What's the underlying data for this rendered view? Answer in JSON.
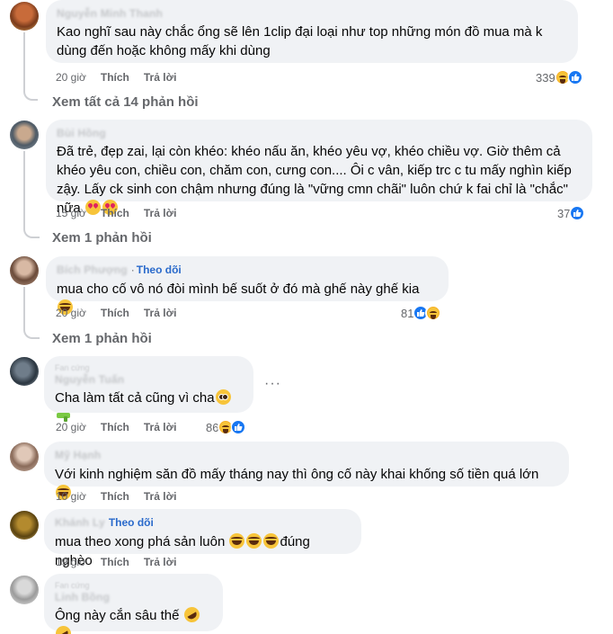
{
  "comments": [
    {
      "author": "Nguyễn Minh Thanh",
      "text": "Kao nghĩ sau này chắc ổng sẽ lên 1clip đại loại như top những món đồ mua mà k dùng đến hoặc không mấy khi dùng",
      "time": "20 giờ",
      "like_label": "Thích",
      "reply_label": "Trả lời",
      "reaction_count": "339",
      "reactions": [
        "haha",
        "like"
      ],
      "replies_label": "Xem tất cả 14 phản hồi"
    },
    {
      "author": "Bùi Hồng",
      "text": "Đã trẻ, đẹp zai, lại còn khéo: khéo nấu ăn, khéo yêu vợ, khéo chiều vợ. Giờ thêm cả khéo yêu con, chiều con, chăm con, cưng con.... Ôi c vân, kiếp trc c tu mấy nghìn kiếp zậy. Lấy ck sinh con chậm nhưng đúng là \"vững cmn chãi\" luôn chứ k fai chỉ là \"chắc\" nữa",
      "time": "15 giờ",
      "like_label": "Thích",
      "reply_label": "Trả lời",
      "reaction_count": "37",
      "reactions": [
        "like"
      ],
      "replies_label": "Xem 1 phản hồi"
    },
    {
      "author": "Bích Phượng",
      "follow_label": "Theo dõi",
      "text": "mua cho cố vô nó đòi mình bế suốt ở đó mà ghế này ghế kia",
      "time": "20 giờ",
      "like_label": "Thích",
      "reply_label": "Trả lời",
      "reaction_count": "81",
      "reactions": [
        "like",
        "haha"
      ],
      "replies_label": "Xem 1 phản hồi"
    },
    {
      "badge": "Fan cứng",
      "author": "Nguyễn Tuấn",
      "text": "Cha làm tất cả cũng vì cha",
      "time": "20 giờ",
      "like_label": "Thích",
      "reply_label": "Trả lời",
      "reaction_count": "86",
      "reactions": [
        "haha",
        "like"
      ],
      "more_label": "···"
    },
    {
      "author": "Mỹ Hạnh",
      "text": "Với kinh nghiệm săn đồ mấy tháng nay thì ông cố này khai khống số tiền quá lớn",
      "time": "10 giờ",
      "like_label": "Thích",
      "reply_label": "Trả lời"
    },
    {
      "author": "Khánh Ly",
      "follow_label": "Theo dõi",
      "text": "mua theo xong phá sản luôn",
      "text_suffix": "đúng nghèo",
      "time": "19 giờ",
      "like_label": "Thích",
      "reply_label": "Trả lời"
    },
    {
      "badge": "Fan cứng",
      "author": "Linh Bồng",
      "text": "Ông này cắn sâu thế",
      "time": "",
      "like_label": "",
      "reply_label": ""
    }
  ],
  "colors": {
    "bubble": "#f0f2f5",
    "meta_text": "#65676b",
    "like_blue": "#1877f2",
    "follow_blue": "#2a6acb",
    "haha_yellow": "#f7b125"
  },
  "icons": {
    "like": "thumbs-up-icon",
    "haha": "laughing-face-icon",
    "more": "ellipsis-icon"
  }
}
